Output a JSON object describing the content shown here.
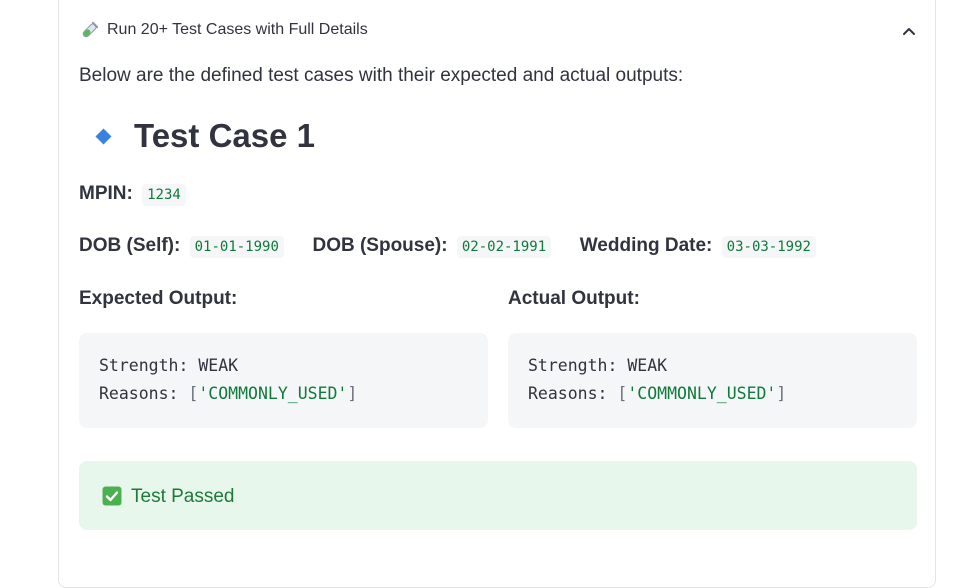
{
  "expander": {
    "title": "Run 20+ Test Cases with Full Details",
    "icon": "test-tube-icon",
    "toggle_icon": "chevron-up-icon"
  },
  "intro": "Below are the defined test cases with their expected and actual outputs:",
  "test_case": {
    "icon": "blue-diamond-icon",
    "title": "Test Case 1",
    "mpin_label": "MPIN:",
    "mpin": "1234",
    "dob_self_label": "DOB (Self):",
    "dob_self": "01-01-1990",
    "dob_spouse_label": "DOB (Spouse):",
    "dob_spouse": "02-02-1991",
    "wedding_label": "Wedding Date:",
    "wedding": "03-03-1992",
    "expected_label": "Expected Output:",
    "actual_label": "Actual Output:",
    "expected": {
      "strength_key": "Strength:",
      "strength": "WEAK",
      "reasons_key": "Reasons:",
      "reason": "'COMMONLY_USED'"
    },
    "actual": {
      "strength_key": "Strength:",
      "strength": "WEAK",
      "reasons_key": "Reasons:",
      "reason": "'COMMONLY_USED'"
    },
    "result_icon": "check-mark-icon",
    "result": "Test Passed"
  },
  "colors": {
    "accent_green": "#0f7a3a",
    "success_bg": "#e8f7ec",
    "diamond_blue": "#3b82e0"
  }
}
